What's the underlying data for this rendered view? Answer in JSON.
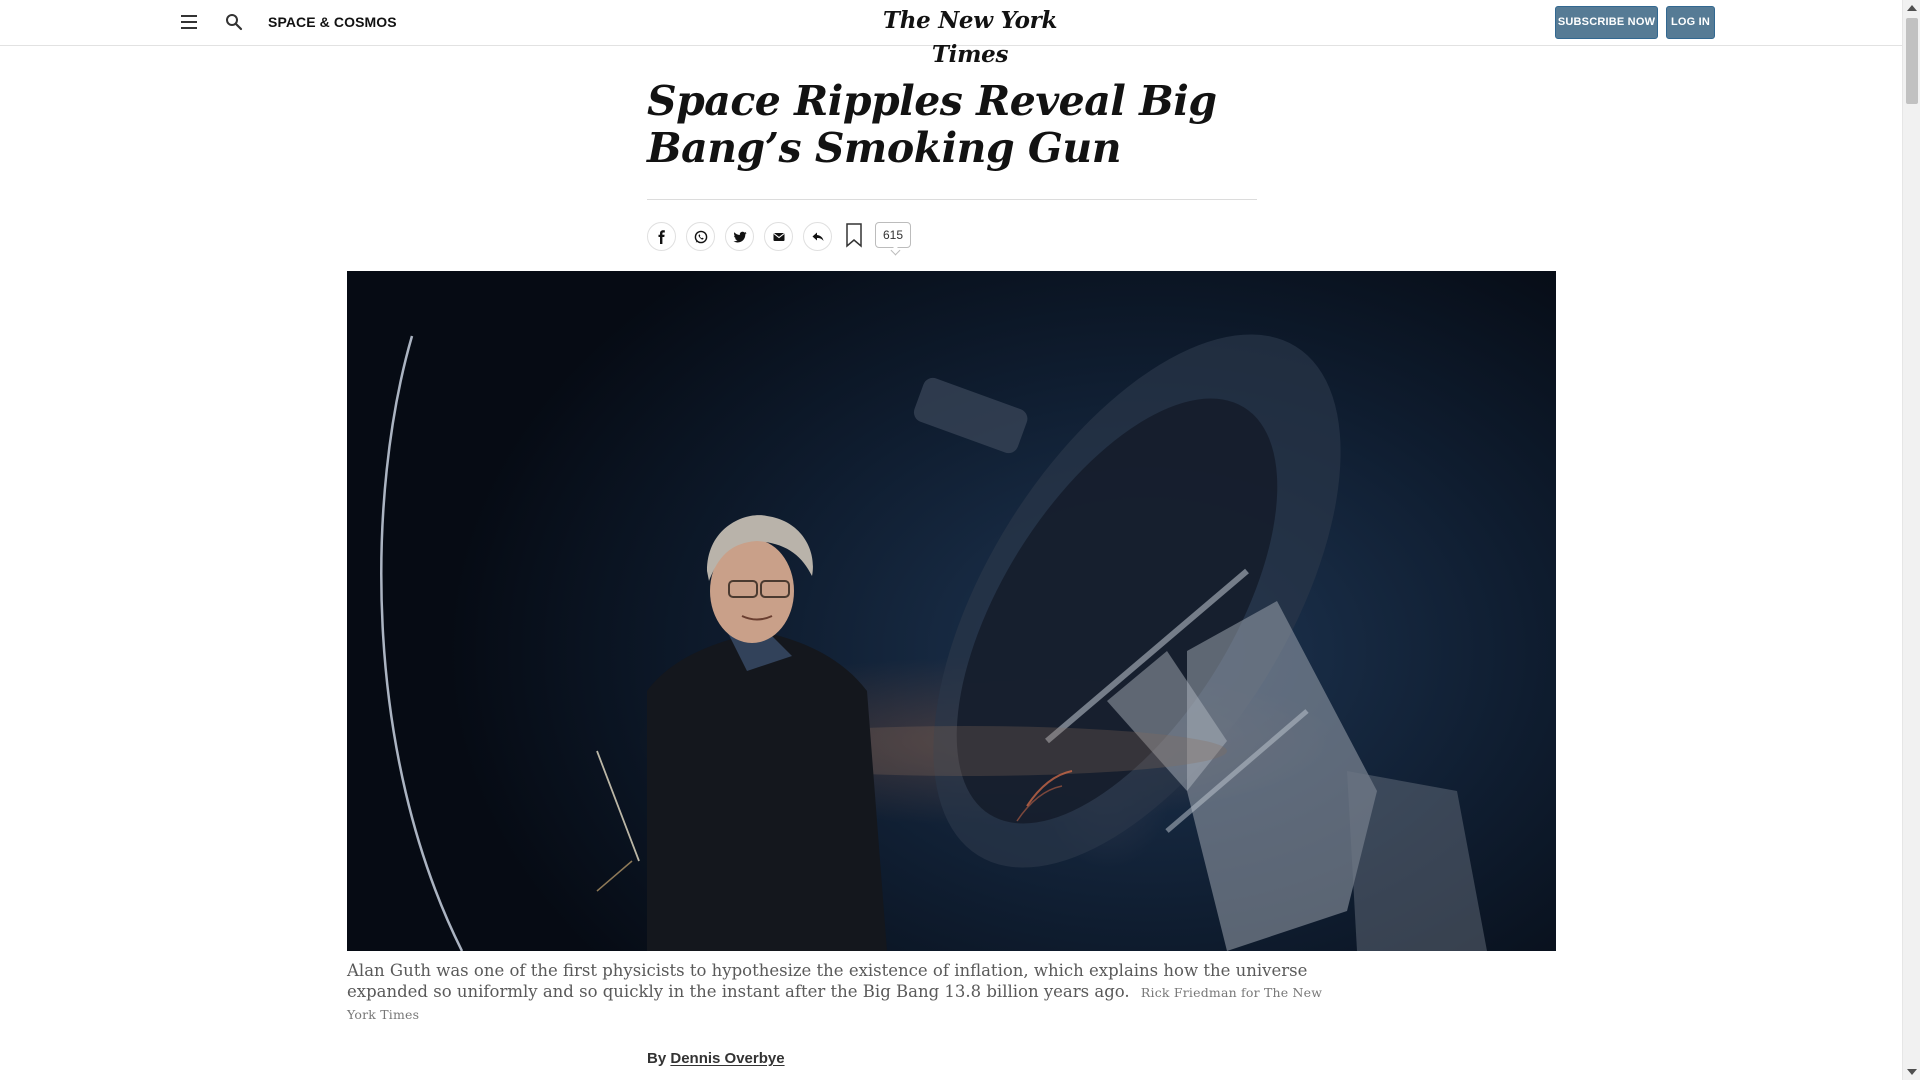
{
  "header": {
    "section_label": "SPACE & COSMOS",
    "masthead": "The New York Times",
    "subscribe_label": "SUBSCRIBE NOW",
    "login_label": "LOG IN",
    "button_color": "#567b95"
  },
  "article": {
    "headline": "Space Ripples Reveal Big Bang’s Smoking Gun",
    "share": {
      "icons": [
        "facebook-icon",
        "whatsapp-icon",
        "twitter-icon",
        "email-icon",
        "share-icon",
        "bookmark-icon"
      ],
      "comment_count": "615"
    },
    "photo": {
      "caption": "Alan Guth was one of the first physicists to hypothesize the existence of inflation, which explains how the universe expanded so uniformly and so quickly in the instant after the Big Bang 13.8 billion years ago.",
      "credit": "Rick Friedman for The New York Times"
    },
    "byline": {
      "prefix": "By",
      "author": "Dennis Overbye"
    }
  }
}
